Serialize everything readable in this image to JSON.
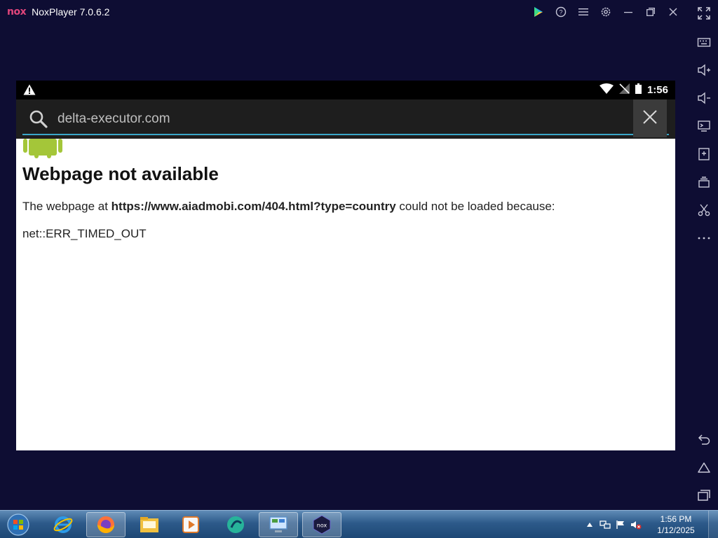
{
  "window": {
    "logo_text": "nox",
    "title": "NoxPlayer 7.0.6.2"
  },
  "title_actions": [
    {
      "name": "play-store-icon"
    },
    {
      "name": "help-icon"
    },
    {
      "name": "menu-icon"
    },
    {
      "name": "settings-icon"
    },
    {
      "name": "minimize-icon"
    },
    {
      "name": "restore-icon"
    },
    {
      "name": "close-icon"
    }
  ],
  "sidebar": {
    "items": [
      {
        "name": "fullscreen-icon"
      },
      {
        "name": "keyboard-icon"
      },
      {
        "name": "volume-up-icon"
      },
      {
        "name": "volume-down-icon"
      },
      {
        "name": "screen-icon"
      },
      {
        "name": "add-apk-icon"
      },
      {
        "name": "multi-instance-icon"
      },
      {
        "name": "scissors-icon"
      },
      {
        "name": "more-icon"
      },
      {
        "name": "back-icon"
      },
      {
        "name": "home-icon"
      },
      {
        "name": "recent-apps-icon"
      }
    ]
  },
  "android": {
    "status": {
      "time": "1:56"
    },
    "search": {
      "query": "delta-executor.com"
    },
    "page": {
      "title": "Webpage not available",
      "line_prefix": "The webpage at ",
      "url": "https://www.aiadmobi.com/404.html?type=country",
      "line_suffix": " could not be loaded because:",
      "error_code": "net::ERR_TIMED_OUT"
    }
  },
  "taskbar": {
    "apps": [
      {
        "name": "internet-explorer-icon"
      },
      {
        "name": "firefox-icon"
      },
      {
        "name": "file-explorer-icon"
      },
      {
        "name": "media-player-icon"
      },
      {
        "name": "green-app-icon"
      },
      {
        "name": "control-panel-icon"
      },
      {
        "name": "noxplayer-taskbar-icon"
      }
    ],
    "clock": {
      "time": "1:56 PM",
      "date": "1/12/2025"
    }
  },
  "colors": {
    "background": "#0e0d33",
    "accent": "#3aa7c9",
    "nox_pink": "#e0457b"
  }
}
